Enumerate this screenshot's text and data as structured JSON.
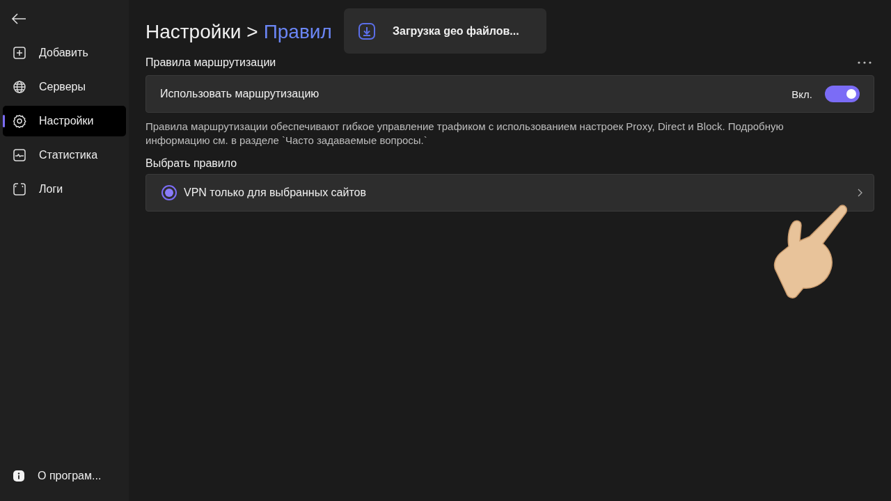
{
  "sidebar": {
    "items": [
      {
        "label": "Добавить",
        "kind": "add",
        "selected": false
      },
      {
        "label": "Серверы",
        "kind": "servers",
        "selected": false
      },
      {
        "label": "Настройки",
        "kind": "settings",
        "selected": true
      },
      {
        "label": "Статистика",
        "kind": "stats",
        "selected": false
      },
      {
        "label": "Логи",
        "kind": "logs",
        "selected": false
      }
    ],
    "footer": {
      "label": "О програм...",
      "selected": false
    }
  },
  "breadcrumb": {
    "parent": "Настройки",
    "separator": ">",
    "current": "Правил"
  },
  "toast": {
    "text": "Загрузка geo файлов..."
  },
  "routing": {
    "title": "Правила маршрутизации",
    "toggle_label": "Использовать маршрутизацию",
    "state_text": "Вкл.",
    "on": true,
    "description": "Правила маршрутизации обеспечивают гибкое управление трафиком с использованием настроек Proxy, Direct и Block. Подробную информацию см. в разделе `Часто задаваемые вопросы.`"
  },
  "rule": {
    "title": "Выбрать правило",
    "options": [
      {
        "label": "VPN только для выбранных сайтов",
        "selected": true
      }
    ]
  }
}
